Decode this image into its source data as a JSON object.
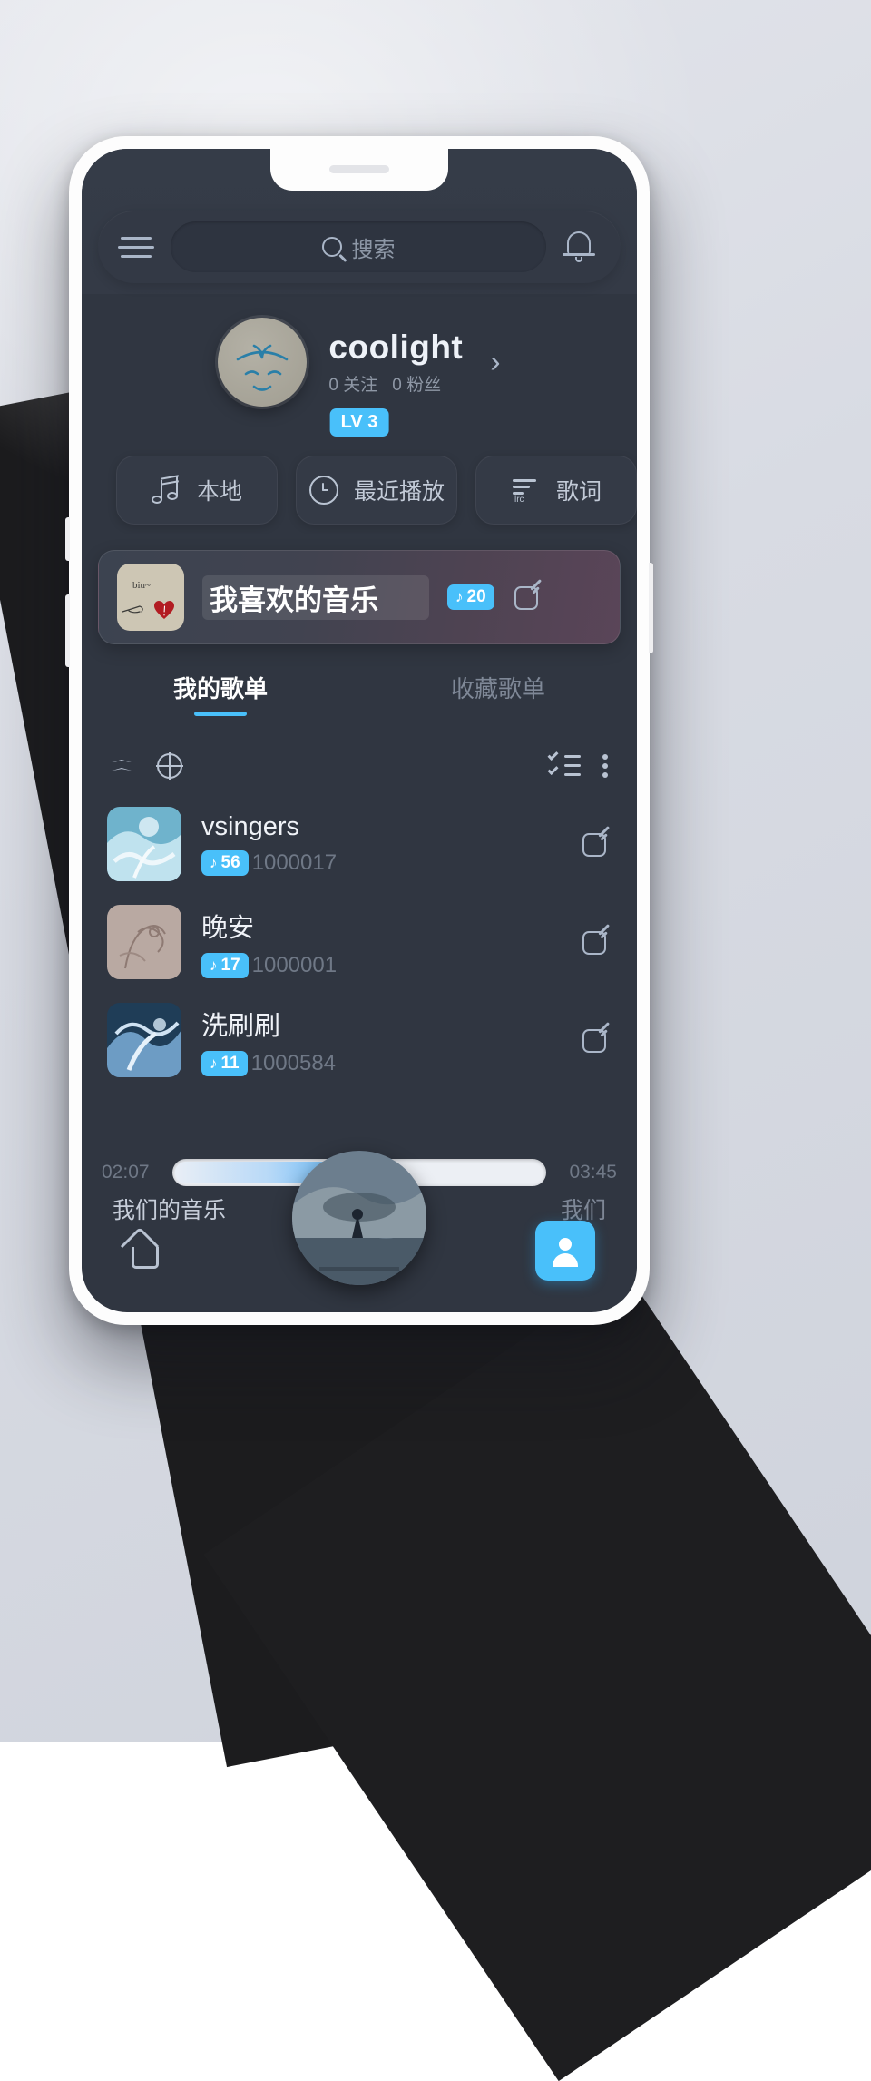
{
  "header": {
    "menu_icon": "hamburger-menu-icon",
    "search_placeholder": "搜索",
    "search_value": "",
    "search_icon": "search-icon",
    "bell_icon": "bell-icon"
  },
  "profile": {
    "username": "coolight",
    "avatar_icon": "avatar",
    "following_count": "0",
    "following_label": "关注",
    "followers_count": "0",
    "followers_label": "粉丝",
    "following_text": "0 关注",
    "followers_text": "0 粉丝",
    "arrow": "›",
    "level_badge": "LV 3"
  },
  "chips": [
    {
      "label": "本地",
      "icon": "music-note-icon"
    },
    {
      "label": "最近播放",
      "icon": "clock-icon"
    },
    {
      "label": "歌词",
      "icon": "lrc-icon",
      "icon_text": "lrc"
    }
  ],
  "favorite_card": {
    "title": "我喜欢的音乐",
    "count": "20",
    "count_icon": "music-note-icon",
    "edit_icon": "edit-icon",
    "thumb_text": "biu~"
  },
  "tabs": [
    {
      "label": "我的歌单",
      "active": true
    },
    {
      "label": "收藏歌单",
      "active": false
    }
  ],
  "list_toolbar": {
    "collapse_icon": "double-chevron-up-icon",
    "add_icon": "add-circle-icon",
    "multiselect_icon": "checklist-icon",
    "more_icon": "more-vertical-icon"
  },
  "playlists": [
    {
      "name": "vsingers",
      "count": "56",
      "id": "1000017",
      "thumb": "teal-illustration",
      "edit_icon": "edit-icon"
    },
    {
      "name": "晚安",
      "count": "17",
      "id": "1000001",
      "thumb": "sketch-illustration",
      "edit_icon": "edit-icon"
    },
    {
      "name": "洗刷刷",
      "count": "11",
      "id": "1000584",
      "thumb": "blue-ink-illustration",
      "edit_icon": "edit-icon"
    }
  ],
  "player": {
    "elapsed": "02:07",
    "duration": "03:45",
    "progress_percent": 57,
    "song_title": "我们的音乐",
    "song_artist": "我们",
    "album_art": "album-cover",
    "home_icon": "home-icon",
    "profile_icon": "person-icon"
  },
  "colors": {
    "accent": "#49c0fa",
    "screen_bg": "#303641",
    "header_bg": "#353c48",
    "card_bg": "#343a46",
    "text_primary": "#f0f3f8",
    "text_muted": "#7f8897"
  }
}
